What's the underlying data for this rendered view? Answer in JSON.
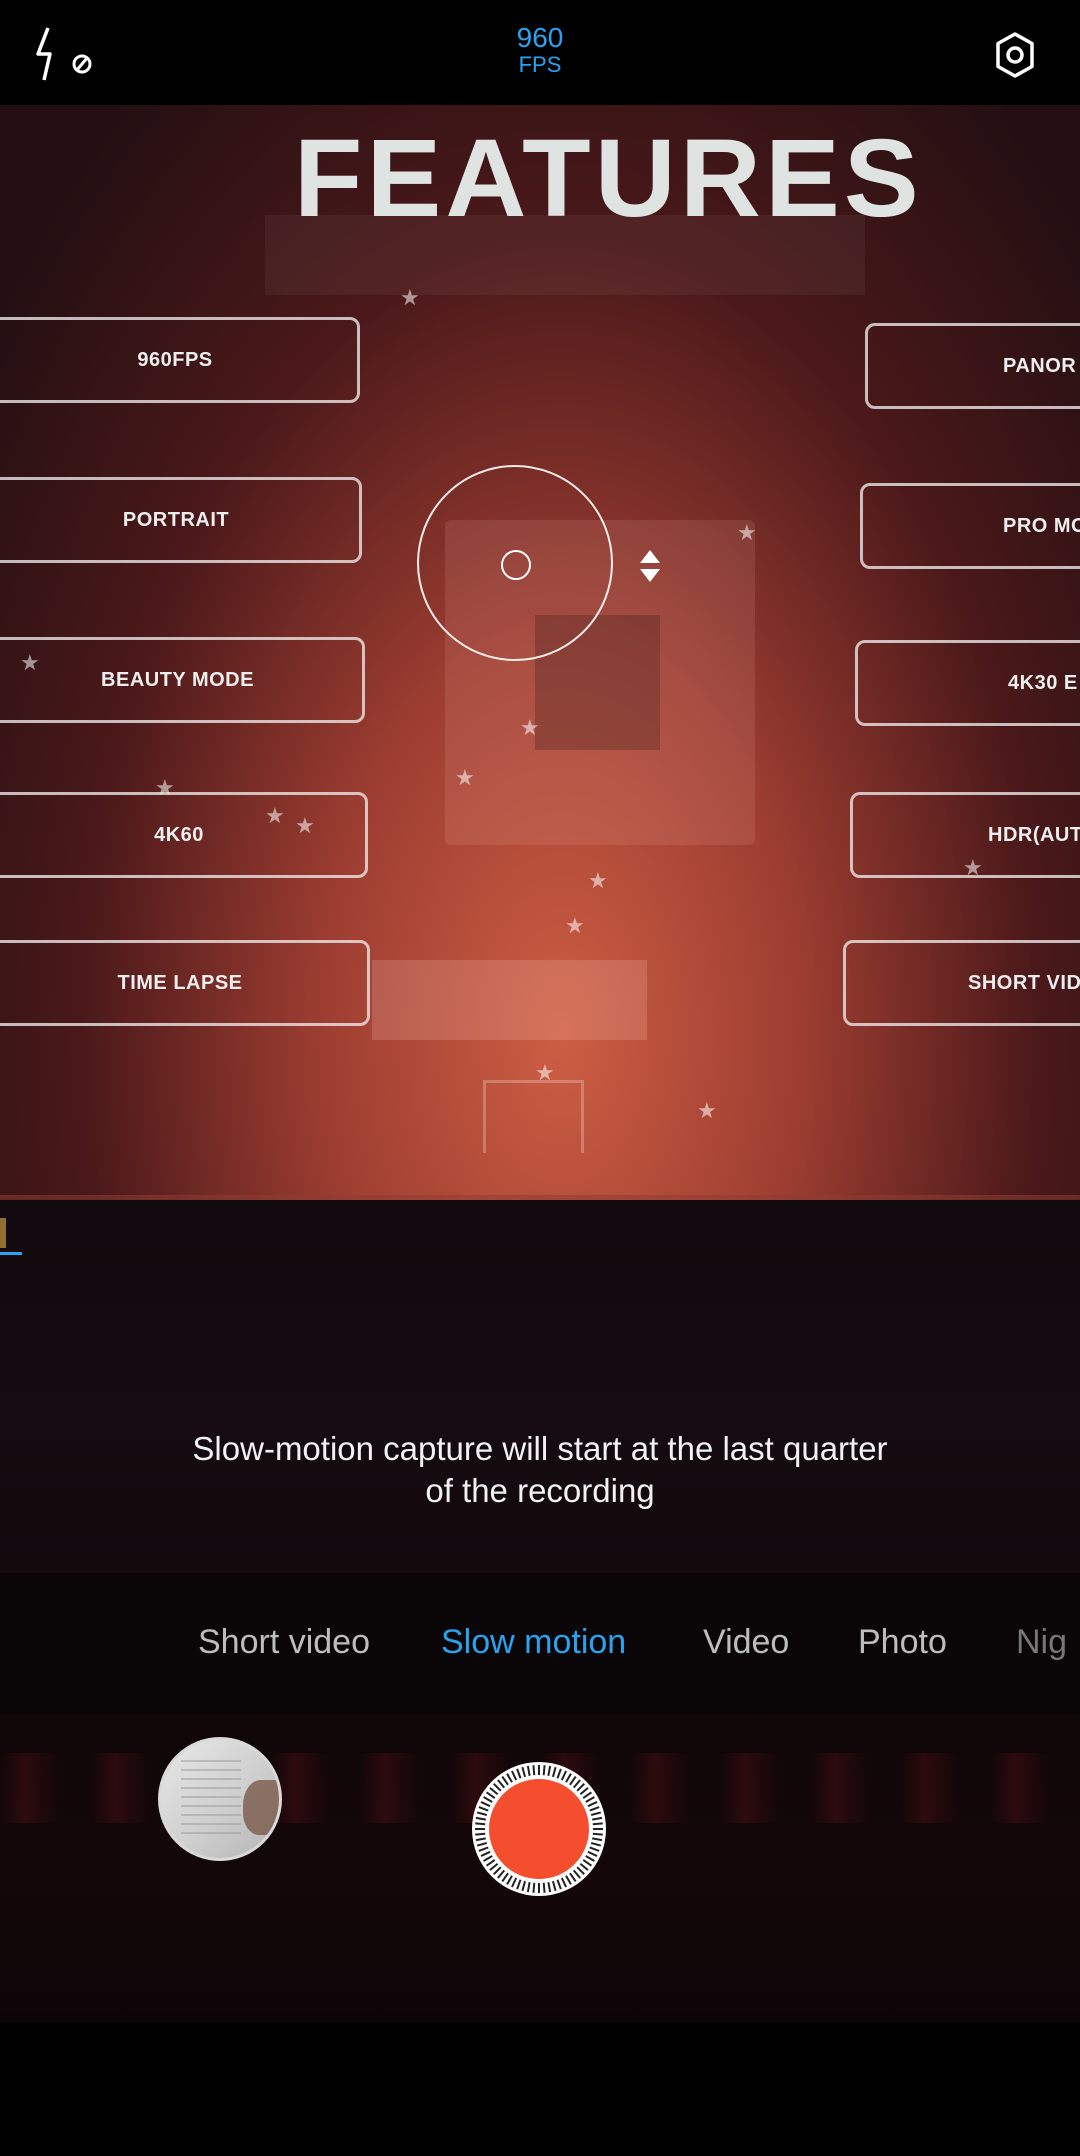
{
  "top_bar": {
    "flash_icon": "flash-off-icon",
    "fps_number": "960",
    "fps_unit": "FPS",
    "settings_icon": "gear-icon",
    "accent_color": "#29a3f0"
  },
  "viewfinder": {
    "title": "FEATURES",
    "left_features": [
      "960FPS",
      "PORTRAIT",
      "BEAUTY MODE",
      "4K60",
      "TIME LAPSE"
    ],
    "right_features": [
      "PANOR",
      "PRO MO",
      "4K30 E",
      "HDR(AUT",
      "SHORT VIDE"
    ],
    "focus_icon": "focus-ring-icon",
    "exposure_icon": "exposure-arrows-icon"
  },
  "hint": {
    "text": "Slow-motion capture will start at the last quarter of the recording"
  },
  "modes": {
    "items": [
      "Short video",
      "Slow motion",
      "Video",
      "Photo",
      "Nig"
    ],
    "selected": "Slow motion"
  },
  "controls": {
    "gallery_icon": "gallery-thumbnail",
    "shutter_icon": "record-button-icon",
    "shutter_color": "#f44e2f"
  }
}
